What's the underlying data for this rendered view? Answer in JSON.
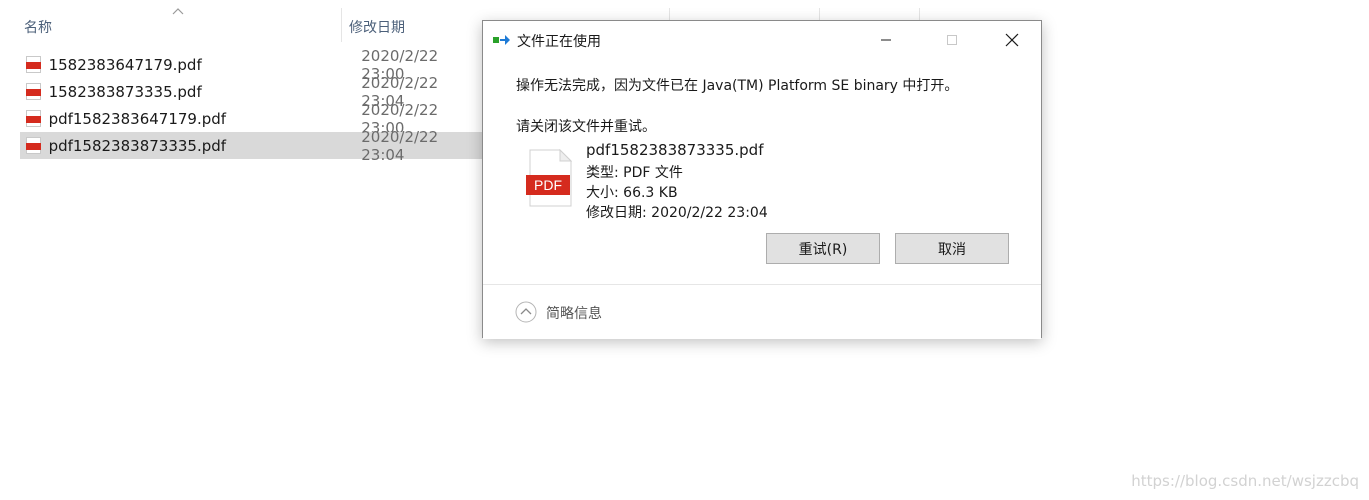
{
  "explorer": {
    "columns": {
      "name": "名称",
      "date": "修改日期"
    },
    "files": [
      {
        "name": "1582383647179.pdf",
        "date": "2020/2/22 23:00"
      },
      {
        "name": "1582383873335.pdf",
        "date": "2020/2/22 23:04"
      },
      {
        "name": "pdf1582383647179.pdf",
        "date": "2020/2/22 23:00"
      },
      {
        "name": "pdf1582383873335.pdf",
        "date": "2020/2/22 23:04",
        "selected": true
      }
    ],
    "file_icon": "pdf-file-icon"
  },
  "dialog": {
    "title": "文件正在使用",
    "message": "操作无法完成，因为文件已在 Java(TM) Platform SE binary 中打开。",
    "instruction": "请关闭该文件并重试。",
    "file": {
      "name": "pdf1582383873335.pdf",
      "type": "类型: PDF 文件",
      "size": "大小: 66.3 KB",
      "modified": "修改日期: 2020/2/22 23:04",
      "icon_text": "PDF"
    },
    "buttons": {
      "retry": "重试(R)",
      "cancel": "取消"
    },
    "footer": {
      "toggle_label": "简略信息"
    },
    "colors": {
      "pdf_red": "#d52b1e",
      "button_bg": "#e1e1e1"
    }
  },
  "watermark": "https://blog.csdn.net/wsjzzcbq"
}
